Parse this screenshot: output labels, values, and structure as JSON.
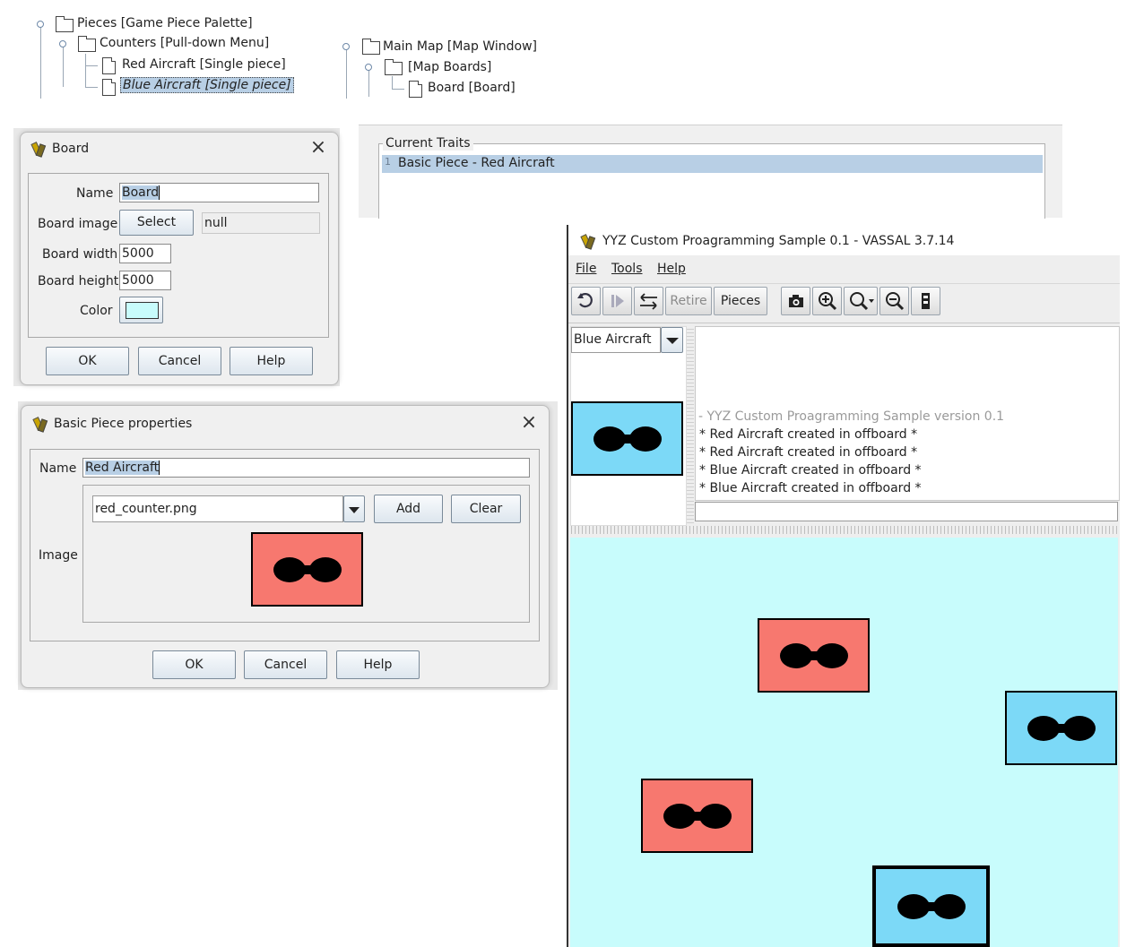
{
  "tree_left": {
    "root": "Pieces [Game Piece Palette]",
    "child": "Counters [Pull-down Menu]",
    "leaves": [
      "Red Aircraft [Single piece]",
      "Blue Aircraft [Single piece]"
    ]
  },
  "tree_right": {
    "root": "Main Map [Map Window]",
    "child": "[Map Boards]",
    "leaf": "Board [Board]"
  },
  "board_dialog": {
    "title": "Board",
    "name_label": "Name",
    "name_value": "Board",
    "image_label": "Board image",
    "select_button": "Select",
    "image_value": "null",
    "width_label": "Board width",
    "width_value": "5000",
    "height_label": "Board height",
    "height_value": "5000",
    "color_label": "Color",
    "color_value": "#c8fcfc",
    "ok": "OK",
    "cancel": "Cancel",
    "help": "Help"
  },
  "traits_panel": {
    "legend": "Current Traits",
    "row_index": "1",
    "row_text": "Basic Piece - Red Aircraft"
  },
  "basic_piece_dialog": {
    "title": "Basic Piece properties",
    "name_label": "Name",
    "name_value": "Red Aircraft",
    "image_label": "Image",
    "image_file": "red_counter.png",
    "add": "Add",
    "clear": "Clear",
    "ok": "OK",
    "cancel": "Cancel",
    "help": "Help"
  },
  "main_window": {
    "title": "YYZ Custom Proagramming Sample 0.1 - VASSAL 3.7.14",
    "menus": [
      "File",
      "Tools",
      "Help"
    ],
    "toolbar": {
      "retire": "Retire",
      "pieces": "Pieces",
      "icons": [
        "undo-icon",
        "step-forward-icon",
        "swap-icon",
        "camera-icon",
        "zoom-in-icon",
        "zoom-menu-icon",
        "zoom-out-icon",
        "counter-icon"
      ]
    },
    "palette_selected": "Blue Aircraft",
    "chat_header": "- YYZ Custom Proagramming Sample version 0.1",
    "chat_lines": [
      "* Red Aircraft created in offboard *",
      "* Red Aircraft created in offboard *",
      "* Blue Aircraft created in offboard *",
      "* Blue Aircraft created in offboard *"
    ],
    "map_background": "#c8fcfc"
  },
  "colors": {
    "red_counter": "#f7786f",
    "blue_counter": "#7cd9f7",
    "selection": "#b8cfe5"
  }
}
